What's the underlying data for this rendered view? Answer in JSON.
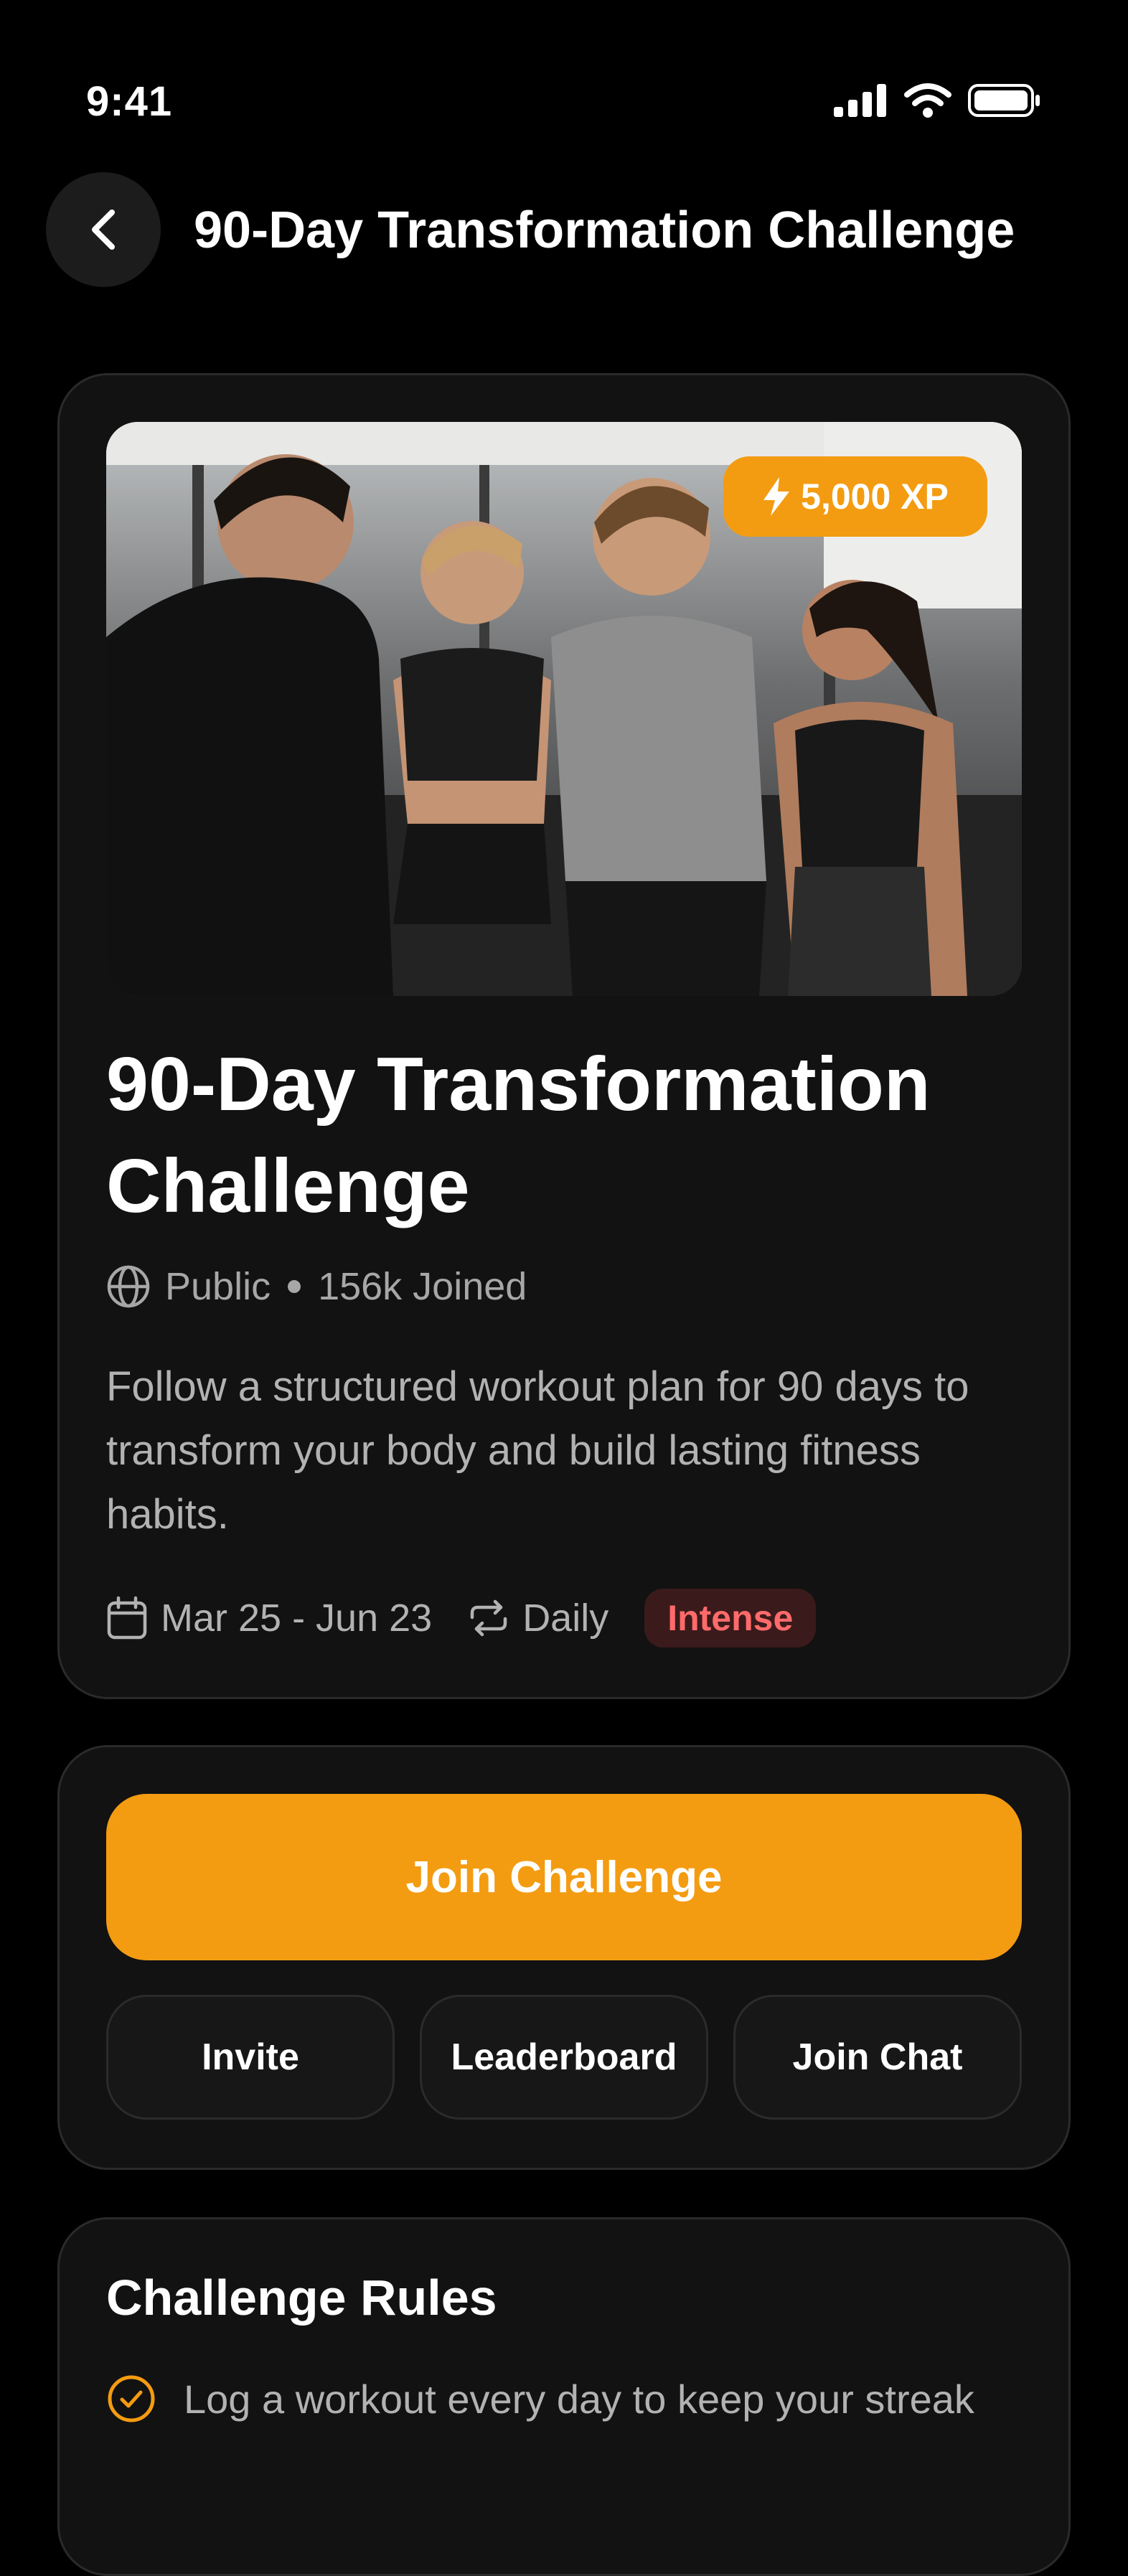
{
  "status_bar": {
    "time": "9:41",
    "icons": [
      "signal-icon",
      "wifi-icon",
      "battery-icon"
    ]
  },
  "header": {
    "title": "90-Day Transformation Challenge",
    "back_icon": "chevron-left-icon"
  },
  "challenge": {
    "xp_badge": "5,000 XP",
    "title": "90-Day Transformation Challenge",
    "visibility": "Public",
    "joined": "156k Joined",
    "description": "Follow a structured workout plan for 90 days to transform your body and build lasting fitness habits.",
    "dates": "Mar 25 - Jun 23",
    "frequency": "Daily",
    "intensity": "Intense"
  },
  "actions": {
    "join_label": "Join Challenge",
    "invite_label": "Invite",
    "leaderboard_label": "Leaderboard",
    "chat_label": "Join Chat"
  },
  "rules": {
    "title": "Challenge Rules",
    "items": [
      "Log a workout every day to keep your streak"
    ]
  },
  "colors": {
    "accent": "#f39c12",
    "background": "#000000",
    "card": "#121212",
    "danger": "#ff6b6b"
  }
}
